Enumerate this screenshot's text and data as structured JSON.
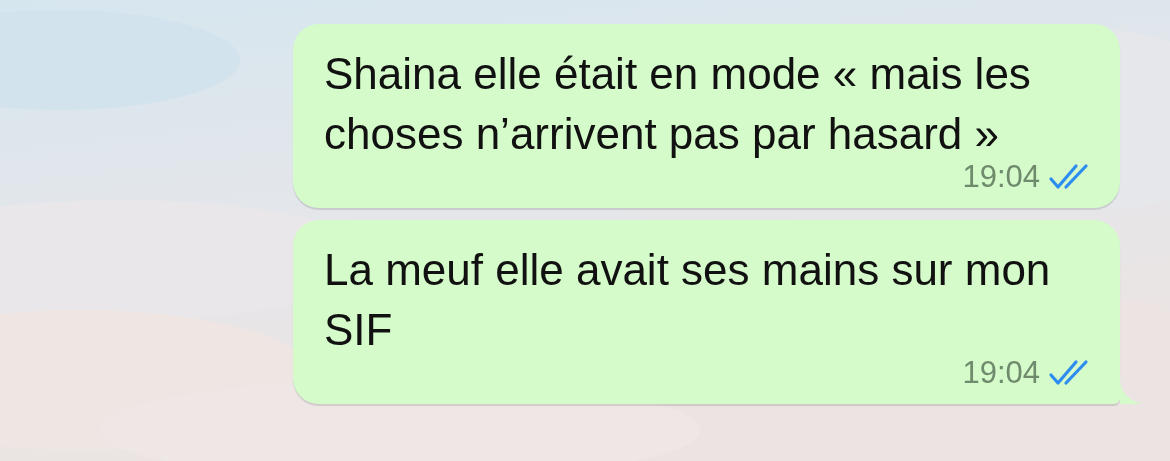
{
  "messages": [
    {
      "text": "Shaina elle était en mode « mais les choses n’arrivent pas par hasard »",
      "time": "19:04",
      "read": true,
      "tail": false
    },
    {
      "text": "La meuf elle avait ses mains sur mon SIF",
      "time": "19:04",
      "read": true,
      "tail": true
    }
  ]
}
